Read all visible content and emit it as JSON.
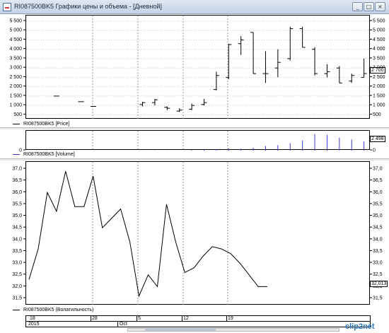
{
  "window": {
    "title": "RI087500BK5 Графики цены и объема - [Дневной]",
    "buttons": {
      "min": "_",
      "max": "□",
      "close": "×"
    }
  },
  "price_pane": {
    "legend": "RI087500BK5 [Price]",
    "series_color": "#000000",
    "last_value_tag": "2 700",
    "y_ticks": [
      "500",
      "1 000",
      "1 500",
      "2 000",
      "2 500",
      "3 000",
      "3 500",
      "4 000",
      "4 500",
      "5 000",
      "5 500"
    ]
  },
  "volume_pane": {
    "legend": "RI087500BK5 [Volume]",
    "series_color": "#3a3ad8",
    "last_value_tag": "2 498",
    "y_ticks": [
      "0"
    ]
  },
  "vol_pane": {
    "legend": "RI087500BK5 (Волатильность)",
    "series_color": "#000000",
    "last_value_tag": "32,013",
    "y_ticks": [
      "31,5",
      "32,0",
      "32,5",
      "33,0",
      "33,5",
      "34,0",
      "34,5",
      "35,0",
      "35,5",
      "36,0",
      "36,5",
      "37,0"
    ]
  },
  "time_axis": {
    "top_labels": [
      "18",
      "28",
      "5",
      "12",
      "19"
    ],
    "bottom_labels": [
      "2015",
      "Oct"
    ]
  },
  "chart_data": [
    {
      "type": "ohlc",
      "name": "RI087500BK5 [Price]",
      "ylim": [
        250,
        5800
      ],
      "bars": [
        [
          2,
          1500,
          1500,
          1500,
          1500
        ],
        [
          4,
          1200,
          1200,
          1200,
          1200
        ],
        [
          5,
          950,
          950,
          950,
          950
        ],
        [
          9,
          1050,
          1200,
          950,
          1150
        ],
        [
          10,
          1150,
          1350,
          1000,
          1300
        ],
        [
          11,
          900,
          950,
          750,
          850
        ],
        [
          12,
          700,
          850,
          650,
          750
        ],
        [
          13,
          800,
          1100,
          750,
          1000
        ],
        [
          14,
          1050,
          1350,
          1000,
          1150
        ],
        [
          15,
          1850,
          2800,
          1800,
          2600
        ],
        [
          16,
          2500,
          4300,
          2400,
          4250
        ],
        [
          17,
          4300,
          4700,
          3700,
          4500
        ],
        [
          18,
          4900,
          4900,
          2700,
          2700
        ],
        [
          19,
          2700,
          3900,
          2200,
          2700
        ],
        [
          20,
          3000,
          4000,
          2500,
          3300
        ],
        [
          21,
          3500,
          5200,
          3400,
          5100
        ],
        [
          22,
          5100,
          5200,
          4100,
          4100
        ],
        [
          23,
          4000,
          4100,
          2600,
          2700
        ],
        [
          24,
          2700,
          3200,
          2500,
          2800
        ],
        [
          25,
          3000,
          3100,
          2200,
          2200
        ],
        [
          26,
          2300,
          2700,
          2200,
          2600
        ],
        [
          27,
          2500,
          3500,
          2500,
          2700
        ]
      ],
      "x_label_indices": [
        0,
        7,
        12,
        17,
        22
      ]
    },
    {
      "type": "bar",
      "name": "RI087500BK5 [Volume]",
      "values": [
        0,
        0,
        2,
        0,
        1,
        0,
        0,
        0,
        0,
        1,
        2,
        1,
        1,
        3,
        5,
        8,
        12,
        10,
        15,
        25,
        30,
        40,
        55,
        90,
        85,
        70,
        60,
        50
      ],
      "ylim": [
        0,
        100
      ]
    },
    {
      "type": "line",
      "name": "RI087500BK5 (Волатильность)",
      "ylim": [
        31.2,
        37.3
      ],
      "x": [
        0,
        1,
        2,
        3,
        4,
        5,
        6,
        7,
        8,
        9,
        10,
        11,
        12,
        13,
        14,
        15,
        16,
        17,
        18,
        19,
        20,
        21,
        22,
        23,
        24,
        25,
        26
      ],
      "values": [
        32.3,
        33.6,
        36.0,
        35.2,
        36.9,
        35.4,
        35.4,
        36.7,
        34.5,
        34.9,
        35.3,
        33.9,
        31.6,
        32.5,
        32.0,
        35.5,
        33.9,
        32.6,
        32.8,
        33.3,
        33.7,
        33.6,
        33.4,
        33.0,
        32.5,
        32.0,
        32.0
      ]
    }
  ]
}
